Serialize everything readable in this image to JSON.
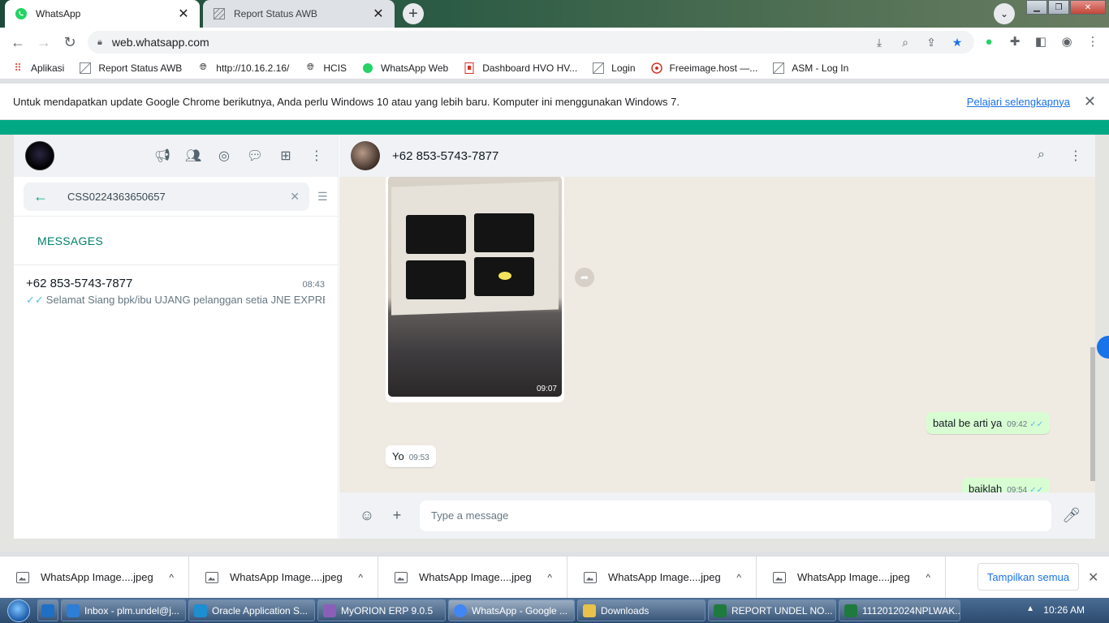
{
  "browser": {
    "tabs": [
      {
        "title": "WhatsApp",
        "active": true
      },
      {
        "title": "Report Status AWB",
        "active": false
      }
    ],
    "url": "web.whatsapp.com",
    "bookmarks": [
      "Aplikasi",
      "Report Status AWB",
      "http://10.16.2.16/",
      "HCIS",
      "WhatsApp Web",
      "Dashboard HVO HV...",
      "Login",
      "Freeimage.host —...",
      "ASM - Log In"
    ],
    "infobar": {
      "message": "Untuk mendapatkan update Google Chrome berikutnya, Anda perlu Windows 10 atau yang lebih baru. Komputer ini menggunakan Windows 7.",
      "link": "Pelajari selengkapnya"
    }
  },
  "whatsapp": {
    "search": {
      "query": "CSS0224363650657"
    },
    "section_label": "MESSAGES",
    "result": {
      "name": "+62 853-5743-7877",
      "time": "08:43",
      "preview": "Selamat Siang   bpk/ibu UJANG pelanggan setia JNE EXPRES..."
    },
    "chat": {
      "contact": "+62 853-5743-7877",
      "messages": [
        {
          "type": "image",
          "time": "09:07",
          "direction": "in"
        },
        {
          "type": "text",
          "text": "batal be arti ya",
          "time": "09:42",
          "direction": "out"
        },
        {
          "type": "text",
          "text": "Yo",
          "time": "09:53",
          "direction": "in"
        },
        {
          "type": "text",
          "text": "baiklah",
          "time": "09:54",
          "direction": "out"
        }
      ]
    },
    "compose_placeholder": "Type a message"
  },
  "downloads": {
    "items": [
      "WhatsApp Image....jpeg",
      "WhatsApp Image....jpeg",
      "WhatsApp Image....jpeg",
      "WhatsApp Image....jpeg",
      "WhatsApp Image....jpeg"
    ],
    "show_all": "Tampilkan semua"
  },
  "taskbar": {
    "items": [
      {
        "label": "Inbox - plm.undel@j...",
        "color": "#2d7ed6"
      },
      {
        "label": "Oracle Application S...",
        "color": "#1c8ed2"
      },
      {
        "label": "MyORION ERP 9.0.5",
        "color": "#8b5fb8"
      },
      {
        "label": "WhatsApp - Google ...",
        "color": "#4285f4"
      },
      {
        "label": "Downloads",
        "color": "#e8c24a"
      },
      {
        "label": "REPORT UNDEL NO...",
        "color": "#1f7a3e"
      },
      {
        "label": "1112012024NPLWAK...",
        "color": "#1f7a3e"
      }
    ],
    "clock": "10:26 AM"
  },
  "colors": {
    "wa_green": "#00a884",
    "bubble_out": "#d9fdd3",
    "tick_blue": "#53bdeb",
    "link_blue": "#1a73e8"
  }
}
